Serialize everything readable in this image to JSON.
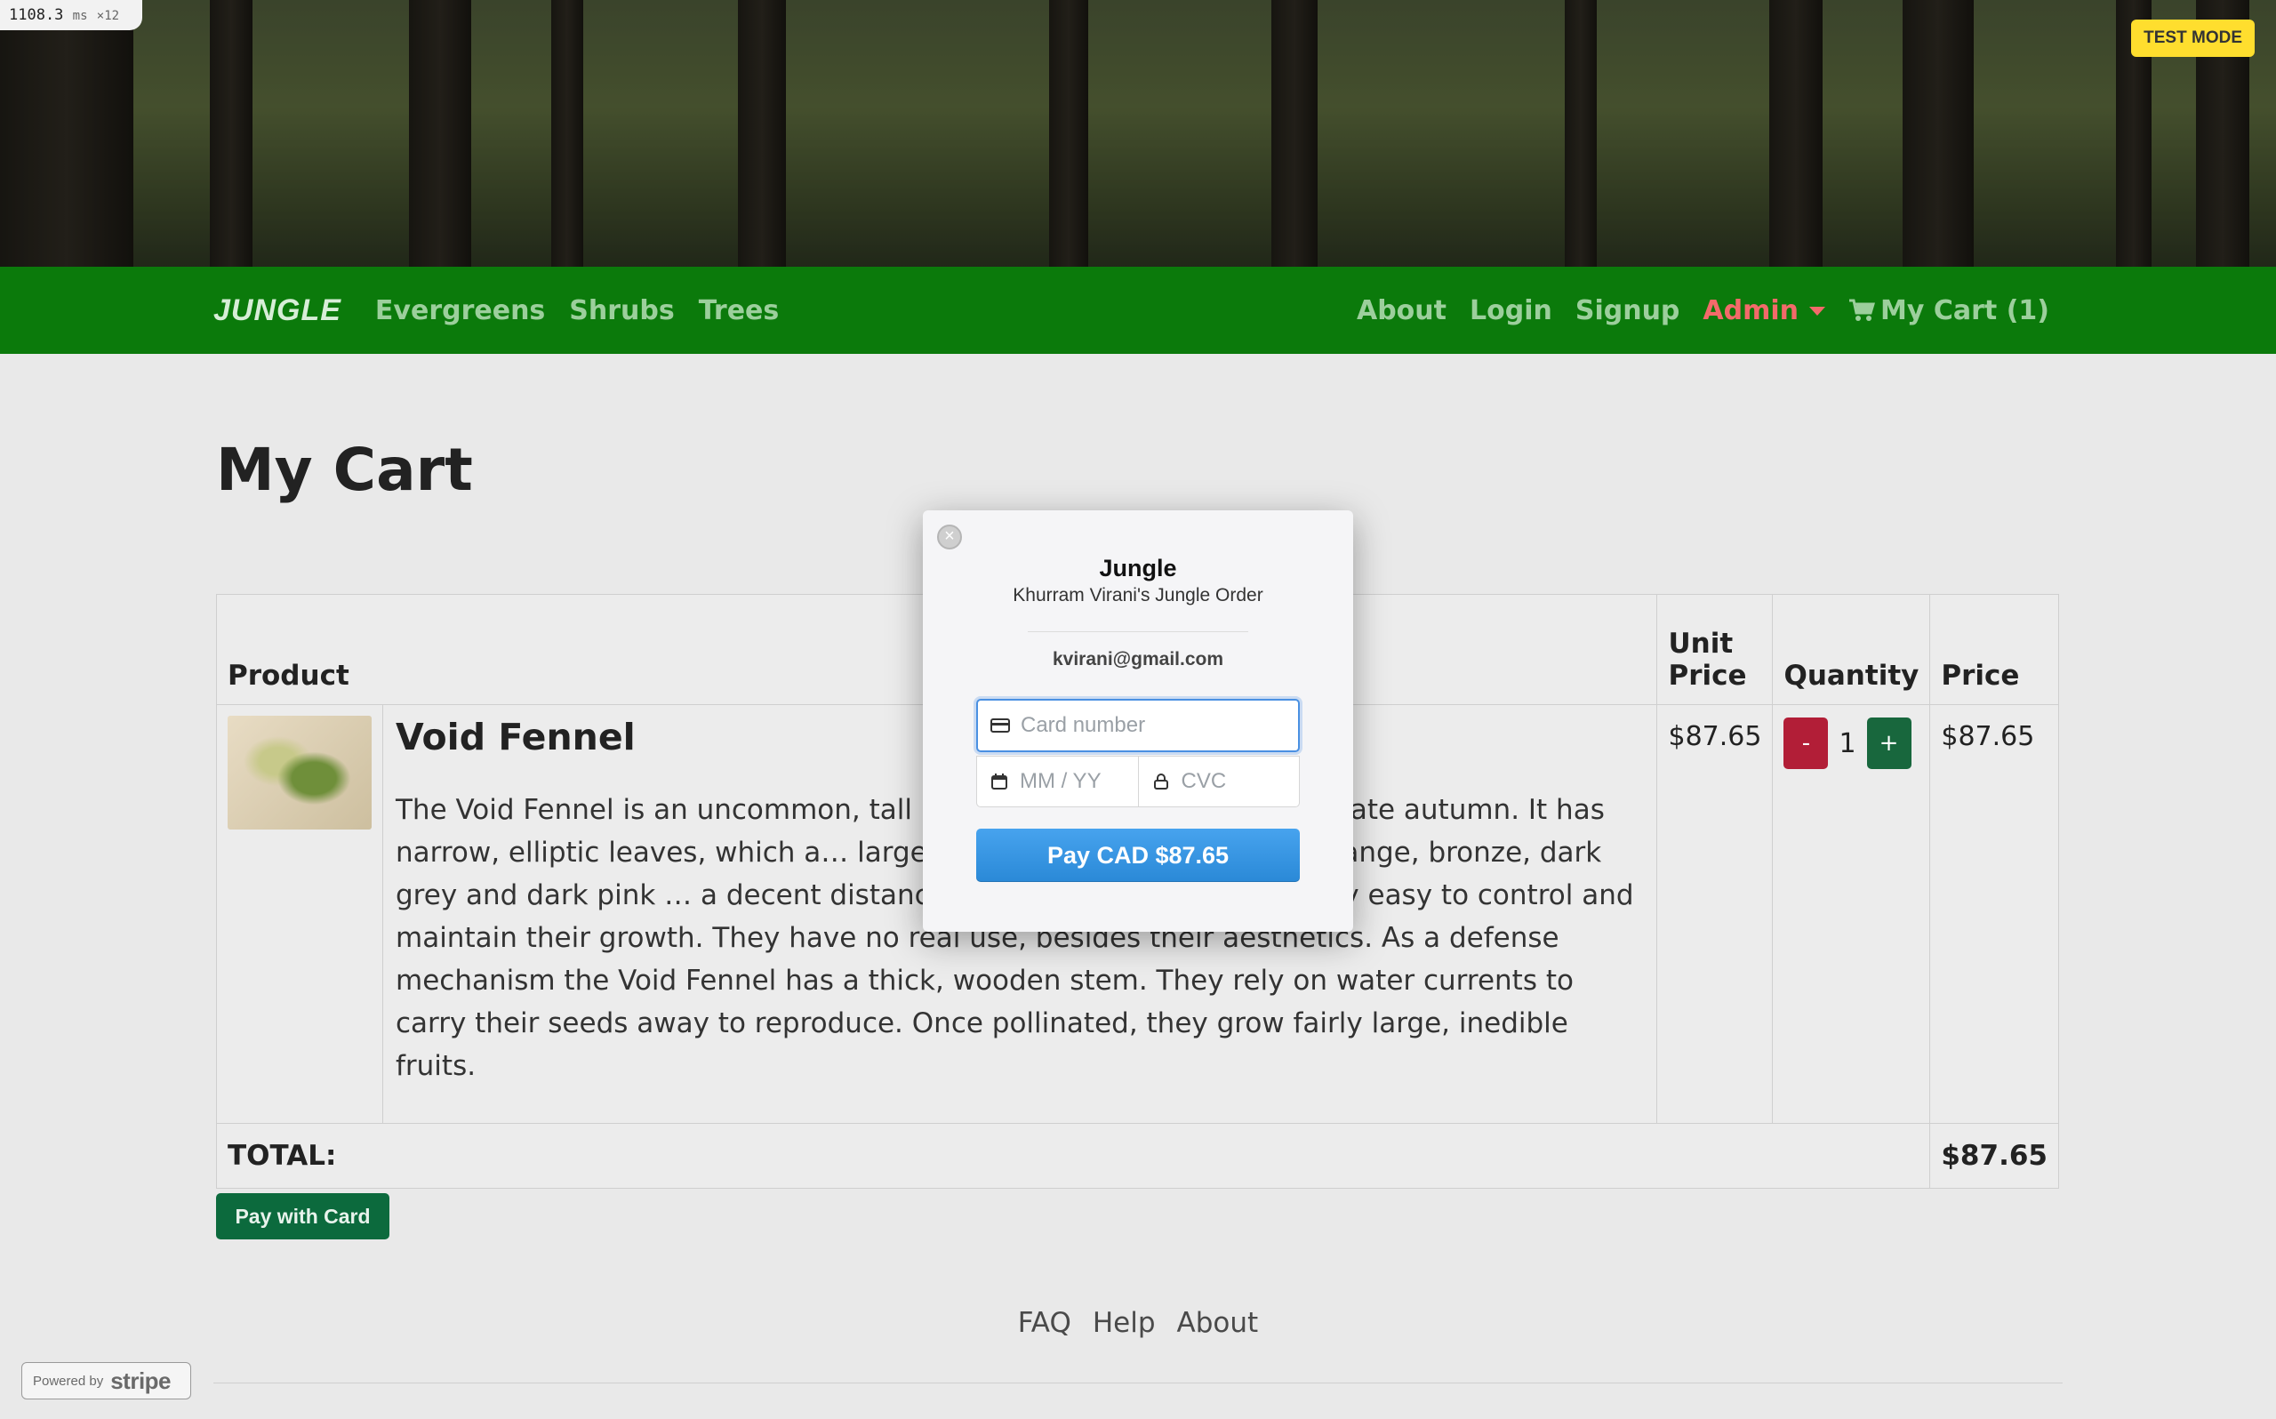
{
  "perf": {
    "value": "1108.3",
    "unit": "ms",
    "mult": "×12"
  },
  "test_mode": "TEST MODE",
  "nav": {
    "brand": "JUNGLE",
    "left": [
      "Evergreens",
      "Shrubs",
      "Trees"
    ],
    "about": "About",
    "login": "Login",
    "signup": "Signup",
    "admin": "Admin",
    "cart": "My Cart (1)"
  },
  "page": {
    "title": "My Cart"
  },
  "table": {
    "headers": {
      "product": "Product",
      "unit_price_1": "Unit",
      "unit_price_2": "Price",
      "quantity": "Quantity",
      "price": "Price"
    },
    "row": {
      "name": "Void Fennel",
      "description": "The Void Fennel is an uncommon, tall plant a… regions. It blooms in late autumn. It has narrow, elliptic leaves, which a… large flowers, which can be dark orange, bronze, dark grey and dark pink … a decent distance from each other, but it's very easy to control and maintain their growth. They have no real use, besides their aesthetics. As a defense mechanism the Void Fennel has a thick, wooden stem. They rely on water currents to carry their seeds away to reproduce. Once pollinated, they grow fairly large, inedible fruits.",
      "unit_price": "$87.65",
      "qty_minus": "-",
      "quantity": "1",
      "qty_plus": "+",
      "price": "$87.65"
    },
    "total_label": "TOTAL:",
    "total_value": "$87.65"
  },
  "pay_with_card": "Pay with Card",
  "footer": [
    "FAQ",
    "Help",
    "About"
  ],
  "stripe_badge": {
    "powered": "Powered by",
    "brand": "stripe"
  },
  "modal": {
    "title": "Jungle",
    "subtitle": "Khurram Virani's Jungle Order",
    "email": "kvirani@gmail.com",
    "card_placeholder": "Card number",
    "exp_placeholder": "MM / YY",
    "cvc_placeholder": "CVC",
    "pay_label": "Pay CAD $87.65",
    "close": "×"
  },
  "colors": {
    "navbar": "#0b7a0b",
    "admin": "#f36a6a",
    "pay_button": "#2a89d7",
    "test_mode": "#ffde2e"
  },
  "icons": [
    "cart-icon",
    "card-icon",
    "calendar-icon",
    "lock-icon",
    "close-icon",
    "caret-down-icon"
  ]
}
